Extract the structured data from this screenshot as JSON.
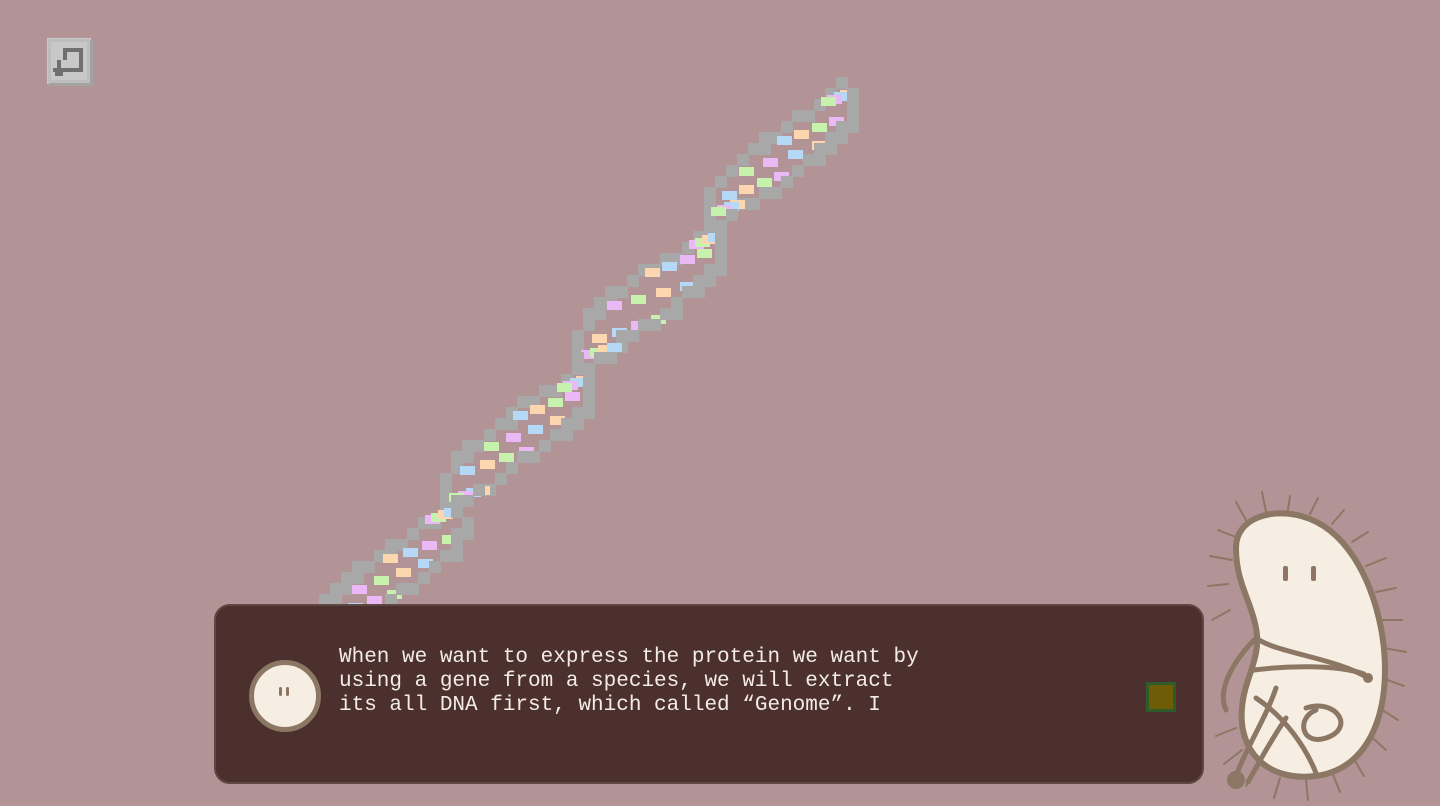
{
  "scene": {
    "background_color": "#b29497",
    "dna_backbone_color": "#a8a8a8",
    "dna_base_colors": [
      "#fcd6ae",
      "#b5d8f7",
      "#eab8f5",
      "#c6f2ad"
    ]
  },
  "hud": {
    "back_icon": "back-arrow-icon"
  },
  "dialog": {
    "text": "When we want to express the protein we want by\nusing a gene from a species, we will extract\nits all DNA first, which called “Genome”. I",
    "box_color": "#4b302d",
    "text_color": "#f3ece6",
    "continue_icon": "square-continue-icon",
    "continue_color": "#6e5c06",
    "avatar_icon": "bacterium-face-icon"
  },
  "character": {
    "icon": "bacterium-mascot-icon",
    "body_color": "#f7eee3",
    "outline_color": "#8b7763"
  }
}
